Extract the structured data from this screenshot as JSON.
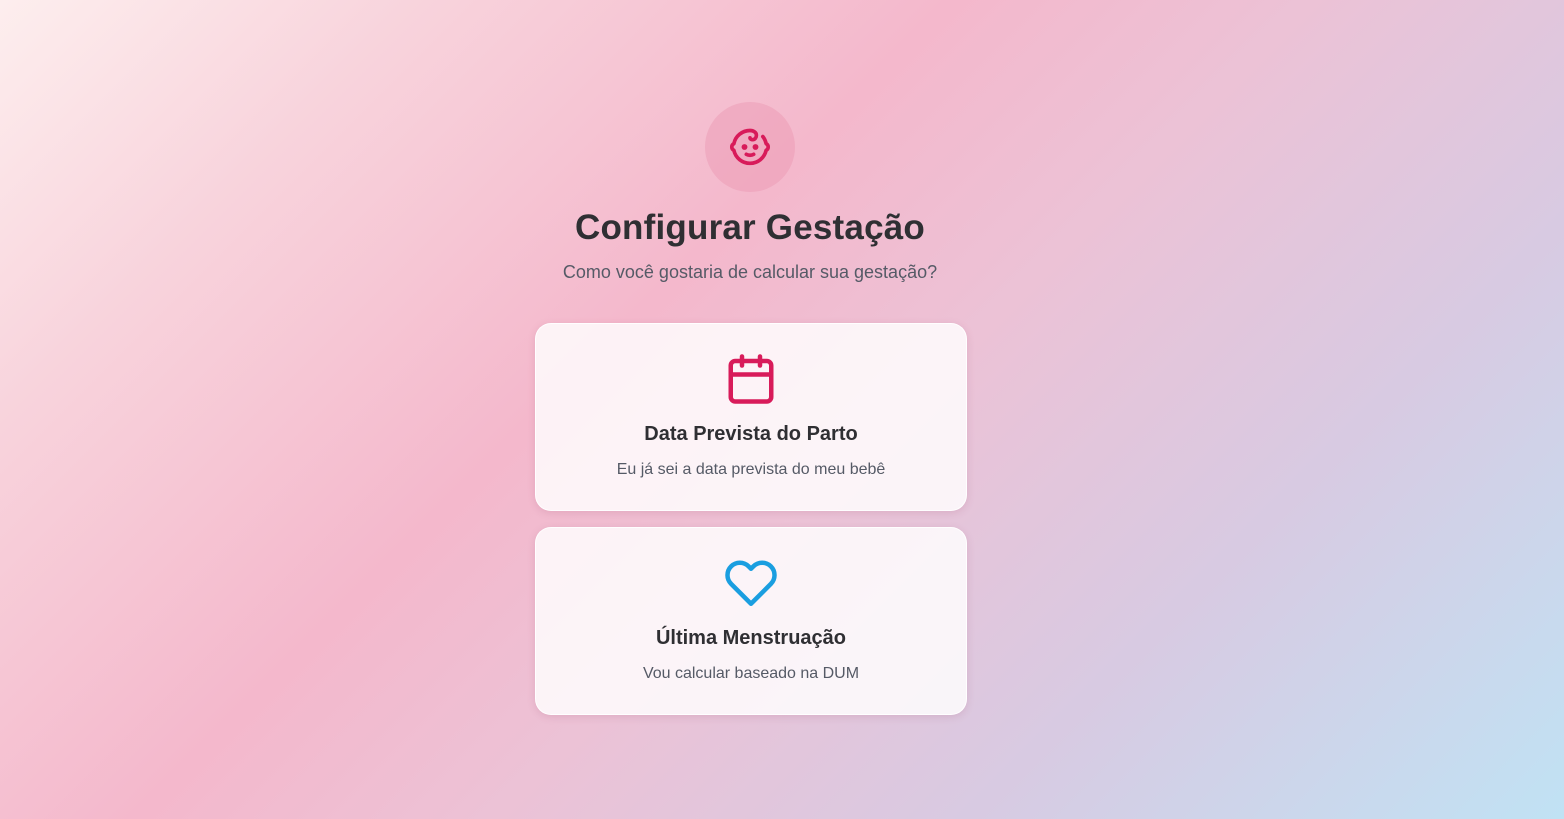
{
  "header": {
    "icon": "baby-face-icon",
    "title": "Configurar Gestação",
    "subtitle": "Como você gostaria de calcular sua gestação?"
  },
  "options": [
    {
      "icon": "calendar-icon",
      "title": "Data Prevista do Parto",
      "description": "Eu já sei a data prevista do meu bebê",
      "icon_color": "#d81b5a"
    },
    {
      "icon": "heart-icon",
      "title": "Última Menstruação",
      "description": "Vou calcular baseado na DUM",
      "icon_color": "#1a9ee0"
    }
  ],
  "colors": {
    "accent_pink": "#d81b5a",
    "accent_blue": "#1a9ee0",
    "text_dark": "#2f2f33",
    "text_muted": "#555a66"
  }
}
